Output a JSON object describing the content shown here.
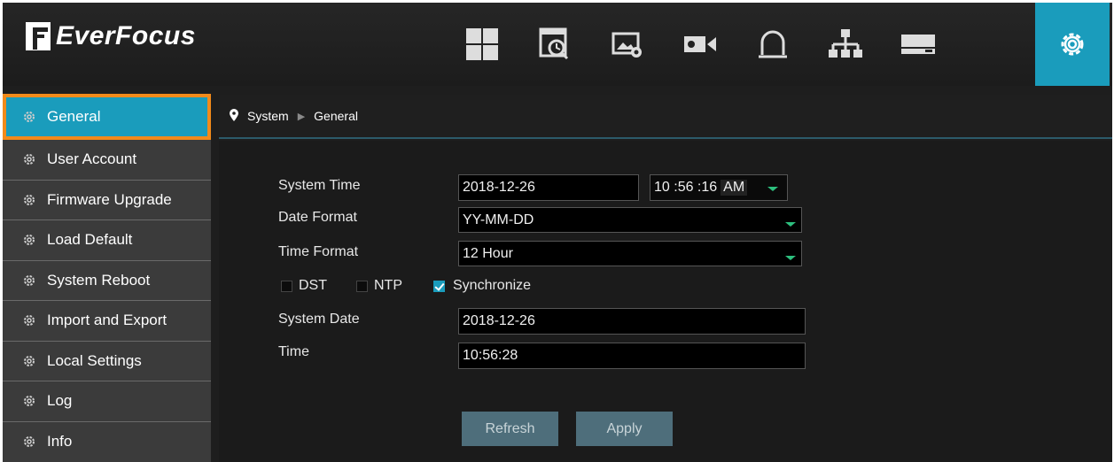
{
  "brand": {
    "logo_text": "EverFocus"
  },
  "toolbar": {
    "icons": [
      "live-view-grid-icon",
      "playback-icon",
      "image-settings-icon",
      "camera-icon",
      "alarm-icon",
      "network-icon",
      "storage-icon",
      "settings-gear-icon"
    ],
    "active": "settings-gear-icon"
  },
  "sidebar": {
    "items": [
      {
        "label": "General",
        "active": true
      },
      {
        "label": "User Account"
      },
      {
        "label": "Firmware Upgrade"
      },
      {
        "label": "Load Default"
      },
      {
        "label": "System Reboot"
      },
      {
        "label": "Import and Export"
      },
      {
        "label": "Local Settings"
      },
      {
        "label": "Log"
      },
      {
        "label": "Info"
      }
    ]
  },
  "breadcrumb": {
    "root": "System",
    "current": "General"
  },
  "form": {
    "system_time_label": "System Time",
    "system_time_date": "2018-12-26",
    "system_time_clock": "10 :56 :16",
    "system_time_ampm": "AM",
    "date_format_label": "Date Format",
    "date_format_value": "YY-MM-DD",
    "time_format_label": "Time Format",
    "time_format_value": "12 Hour",
    "dst_label": "DST",
    "ntp_label": "NTP",
    "sync_label": "Synchronize",
    "dst_checked": false,
    "ntp_checked": false,
    "sync_checked": true,
    "system_date_label": "System Date",
    "system_date_value": "2018-12-26",
    "time_label": "Time",
    "time_value": "10:56:28"
  },
  "buttons": {
    "refresh": "Refresh",
    "apply": "Apply"
  },
  "colors": {
    "accent": "#1a9cbc",
    "highlight_border": "#f28a1a",
    "dropdown_arrow": "#2dbf7e"
  }
}
